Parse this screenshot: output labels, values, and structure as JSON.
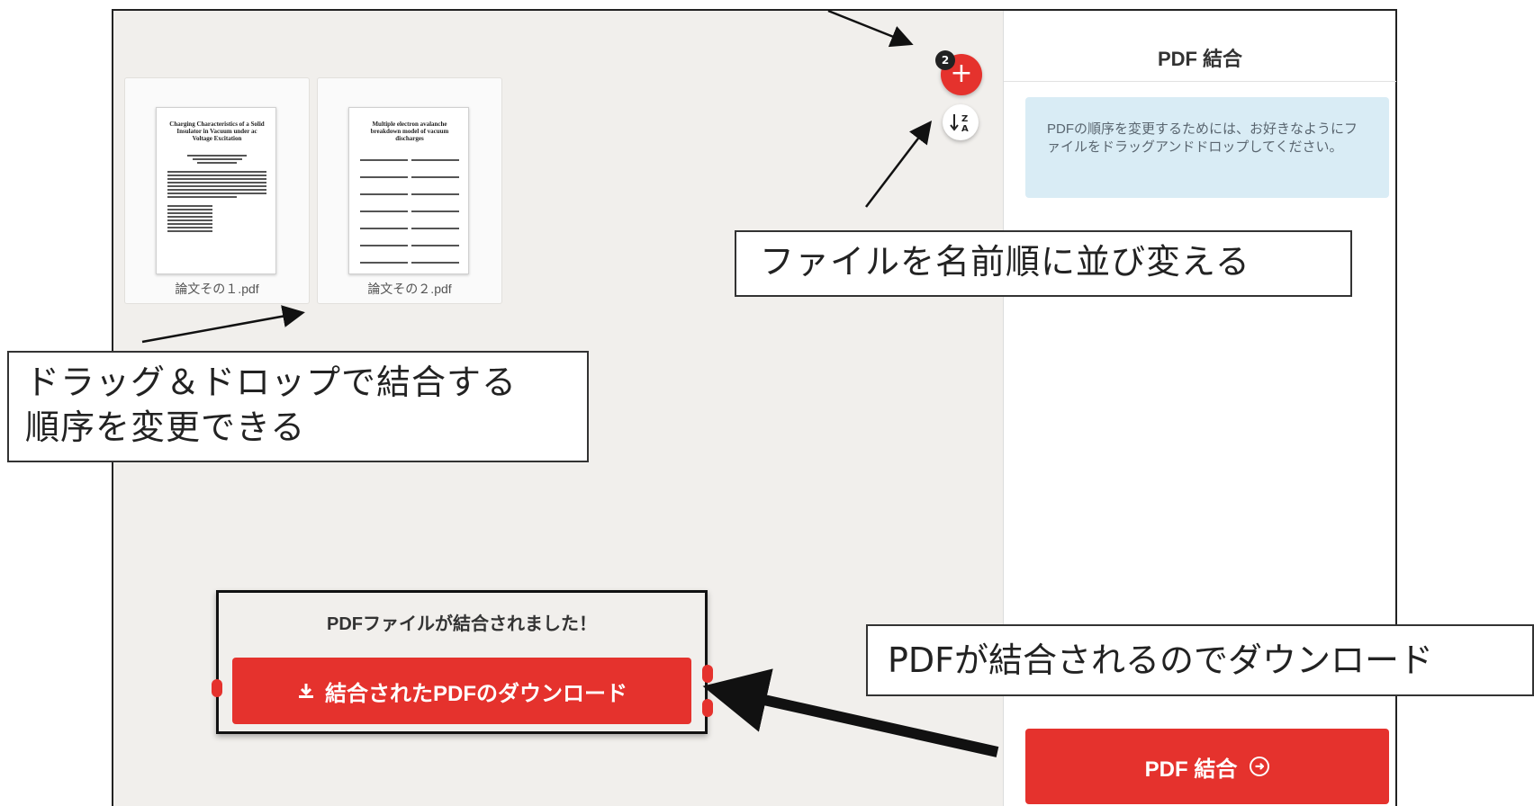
{
  "sidebar": {
    "title": "PDF 結合",
    "info": "PDFの順序を変更するためには、お好きなようにファイルをドラッグアンドドロップしてください。",
    "merge_button": "PDF 結合",
    "merge_icon": "circle-arrow-right-icon"
  },
  "toolbar": {
    "file_count": "2",
    "add_icon": "plus-icon",
    "sort_icon": "sort-za-icon"
  },
  "files": [
    {
      "name": "論文その１.pdf",
      "thumb_title": "Charging Characteristics of a Solid Insulator in Vacuum under ac Voltage Excitation"
    },
    {
      "name": "論文その２.pdf",
      "thumb_title": "Multiple electron avalanche breakdown model of vacuum discharges"
    }
  ],
  "success": {
    "message": "PDFファイルが結合されました！",
    "download_button": "結合されたPDFのダウンロード",
    "download_icon": "download-icon"
  },
  "annotations": {
    "sort": "ファイルを名前順に並び変える",
    "drag_line1": "ドラッグ＆ドロップで結合する",
    "drag_line2": "順序を変更できる",
    "download": "PDFが結合されるのでダウンロード"
  },
  "colors": {
    "accent": "#e5322d",
    "info_bg": "#d9ecf5",
    "workspace_bg": "#f1efec"
  }
}
